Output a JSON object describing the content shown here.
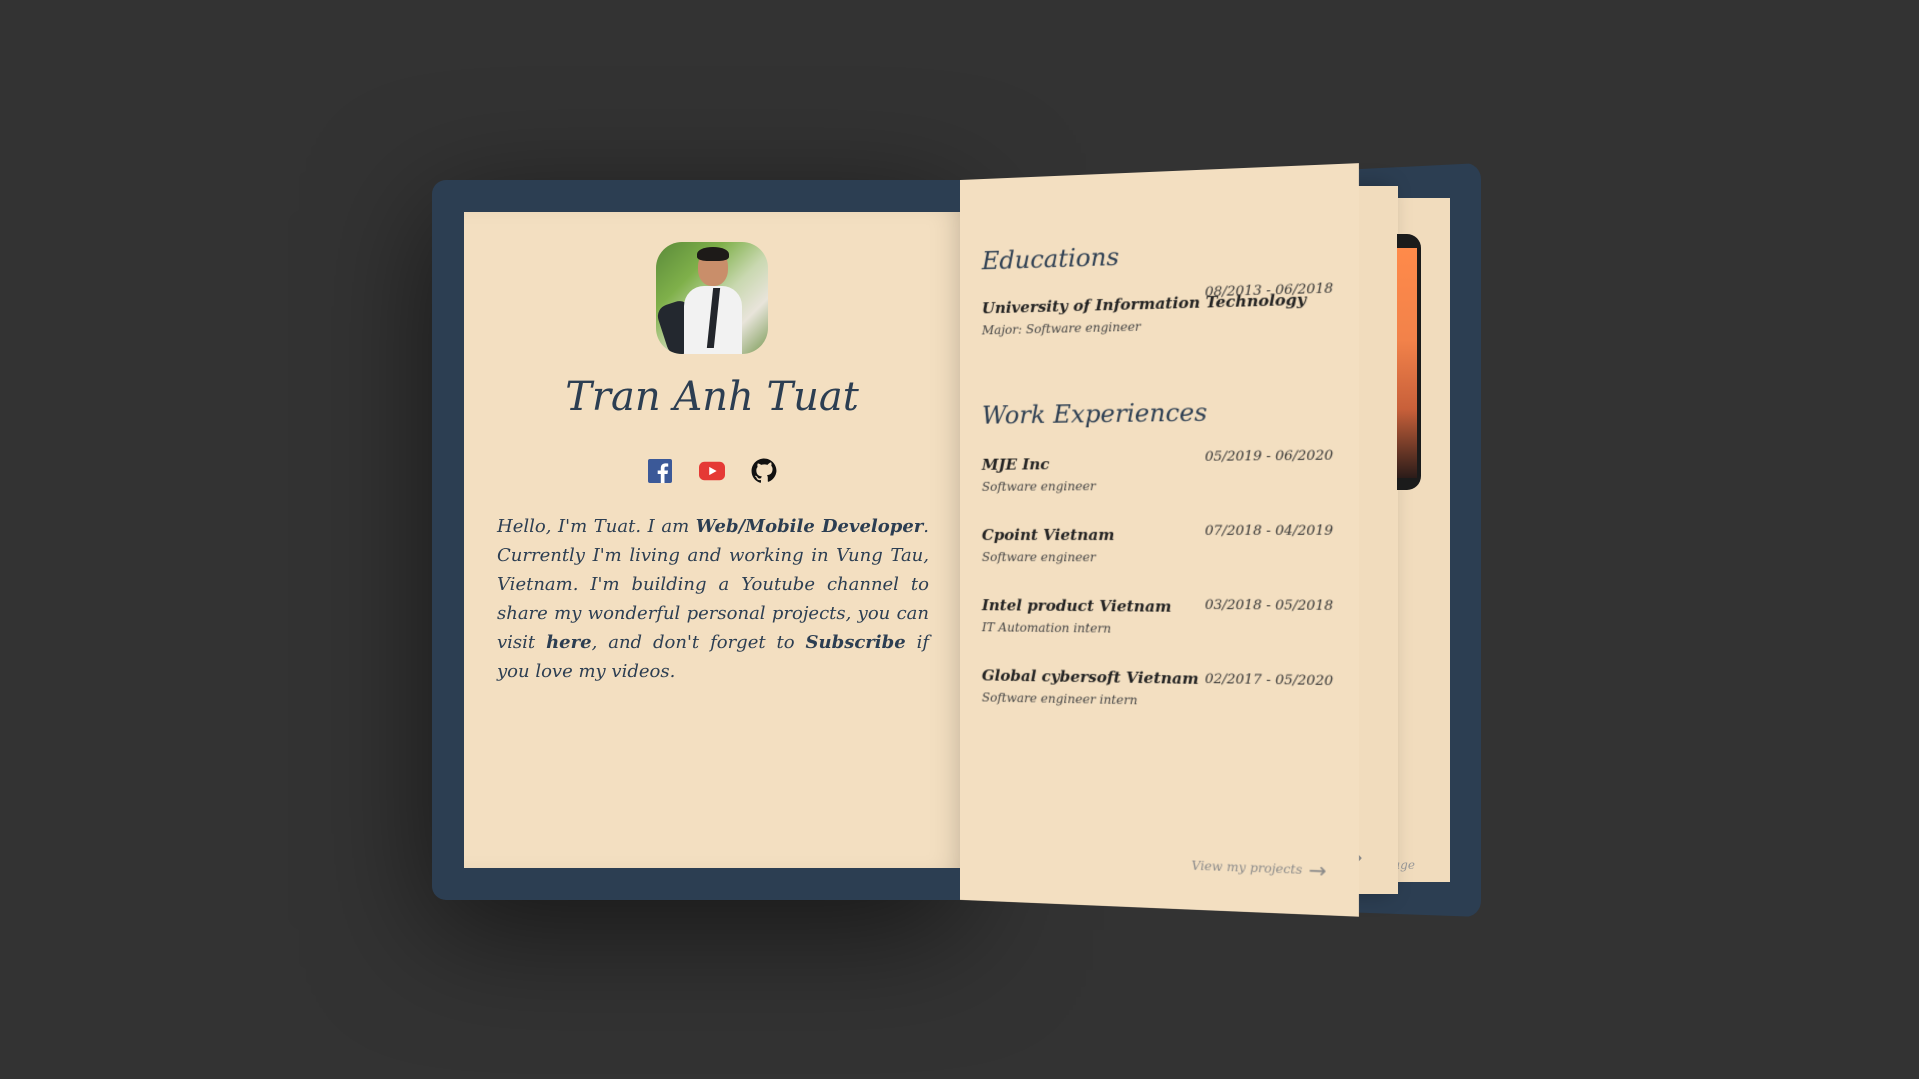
{
  "profile": {
    "name": "Tran Anh Tuat",
    "bio": {
      "p1": "Hello, I'm Tuat. I am ",
      "role": "Web/Mobile Developer",
      "p2": ". Currently I'm living and working in Vung Tau, Vietnam. I'm building a Youtube channel to share my wonderful personal projects, you can visit ",
      "here": "here",
      "p3": ", and don't forget to ",
      "subscribe": "Subscribe",
      "p4": " if you love my videos."
    }
  },
  "socials": [
    {
      "icon": "facebook-icon",
      "color": "#3b5998"
    },
    {
      "icon": "youtube-icon",
      "color": "#e53935"
    },
    {
      "icon": "github-icon",
      "color": "#111111"
    }
  ],
  "education": {
    "title": "Educations",
    "items": [
      {
        "school": "University of Information Technology",
        "major": "Major: Software engineer",
        "date": "08/2013 - 06/2018"
      }
    ]
  },
  "work": {
    "title": "Work Experiences",
    "items": [
      {
        "company": "MJE Inc",
        "role": "Software engineer",
        "date": "05/2019 - 06/2020"
      },
      {
        "company": "Cpoint Vietnam",
        "role": "Software engineer",
        "date": "07/2018 - 04/2019"
      },
      {
        "company": "Intel product Vietnam",
        "role": "IT Automation intern",
        "date": "03/2018 - 05/2018"
      },
      {
        "company": "Global cybersoft Vietnam",
        "role": "Software engineer intern",
        "date": "02/2017 - 05/2020"
      }
    ]
  },
  "nav": {
    "next_label": "View my projects",
    "back_page_label": "age"
  },
  "colors": {
    "background": "#333333",
    "cover": "#2c3e52",
    "paper": "#f3dfc1",
    "ink": "#2c3e52"
  }
}
